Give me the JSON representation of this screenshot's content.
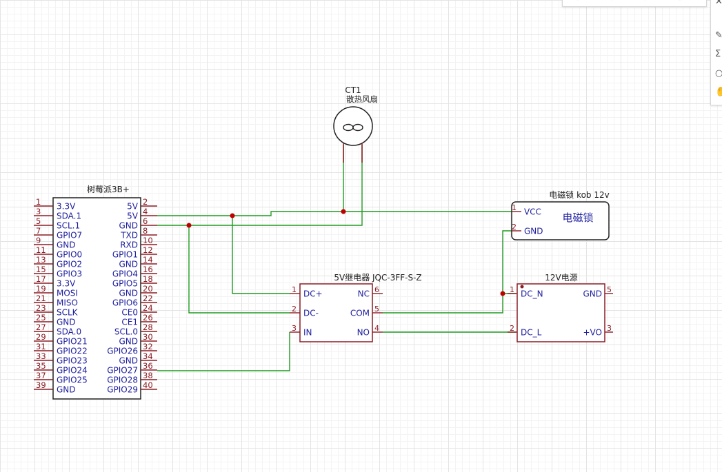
{
  "colors": {
    "symbol": "#8a1c24",
    "wire": "#1f9a1f",
    "junction": "#c00000",
    "label": "#1c1c9e",
    "title": "#202020",
    "pin_number": "#8a1c24"
  },
  "toolbar": {
    "top_glyphs": [
      "«",
      "‹",
      "›",
      "»"
    ],
    "side_icons": [
      "close-icon",
      "pencil-icon",
      "sigma-icon",
      "circle-icon",
      "hand-icon"
    ],
    "side_glyphs": [
      "✕",
      "✎",
      "Σ",
      "○",
      "✋"
    ]
  },
  "components": {
    "rpi": {
      "title": "树莓派3B+",
      "left_pins": [
        {
          "num": "1",
          "label": "3.3V"
        },
        {
          "num": "3",
          "label": "SDA.1"
        },
        {
          "num": "5",
          "label": "SCL.1"
        },
        {
          "num": "7",
          "label": "GPIO7"
        },
        {
          "num": "9",
          "label": "GND"
        },
        {
          "num": "11",
          "label": "GPIO0"
        },
        {
          "num": "13",
          "label": "GPIO2"
        },
        {
          "num": "15",
          "label": "GPIO3"
        },
        {
          "num": "17",
          "label": "3.3V"
        },
        {
          "num": "19",
          "label": "MOSI"
        },
        {
          "num": "21",
          "label": "MISO"
        },
        {
          "num": "23",
          "label": "SCLK"
        },
        {
          "num": "25",
          "label": "GND"
        },
        {
          "num": "27",
          "label": "SDA.0"
        },
        {
          "num": "29",
          "label": "GPIO21"
        },
        {
          "num": "31",
          "label": "GPIO22"
        },
        {
          "num": "33",
          "label": "GPIO23"
        },
        {
          "num": "35",
          "label": "GPIO24"
        },
        {
          "num": "37",
          "label": "GPIO25"
        },
        {
          "num": "39",
          "label": "GND"
        }
      ],
      "right_pins": [
        {
          "num": "2",
          "label": "5V"
        },
        {
          "num": "4",
          "label": "5V"
        },
        {
          "num": "6",
          "label": "GND"
        },
        {
          "num": "8",
          "label": "TXD"
        },
        {
          "num": "10",
          "label": "RXD"
        },
        {
          "num": "12",
          "label": "GPIO1"
        },
        {
          "num": "14",
          "label": "GND"
        },
        {
          "num": "16",
          "label": "GPIO4"
        },
        {
          "num": "18",
          "label": "GPIO5"
        },
        {
          "num": "20",
          "label": "GND"
        },
        {
          "num": "22",
          "label": "GPIO6"
        },
        {
          "num": "24",
          "label": "CE0"
        },
        {
          "num": "26",
          "label": "CE1"
        },
        {
          "num": "28",
          "label": "SCL.0"
        },
        {
          "num": "30",
          "label": "GND"
        },
        {
          "num": "32",
          "label": "GPIO26"
        },
        {
          "num": "34",
          "label": "GND"
        },
        {
          "num": "36",
          "label": "GPIO27"
        },
        {
          "num": "38",
          "label": "GPIO28"
        },
        {
          "num": "40",
          "label": "GPIO29"
        }
      ]
    },
    "fan": {
      "ref": "CT1",
      "name": "散热风扇"
    },
    "lock": {
      "title": "电磁锁 kob 12v",
      "center_label": "电磁锁",
      "pins": [
        {
          "num": "1",
          "label": "VCC"
        },
        {
          "num": "2",
          "label": "GND"
        }
      ]
    },
    "relay": {
      "title": "5V继电器 JQC-3FF-S-Z",
      "left_pins": [
        {
          "num": "1",
          "label": "DC+"
        },
        {
          "num": "2",
          "label": "DC-"
        },
        {
          "num": "3",
          "label": "IN"
        }
      ],
      "right_pins": [
        {
          "num": "6",
          "label": "NC"
        },
        {
          "num": "5",
          "label": "COM"
        },
        {
          "num": "4",
          "label": "NO"
        }
      ]
    },
    "psu": {
      "title": "12V电源",
      "left_pins": [
        {
          "num": "1",
          "label": "DC_N"
        },
        {
          "num": "2",
          "label": "DC_L"
        }
      ],
      "right_pins": [
        {
          "num": "5",
          "label": "GND"
        },
        {
          "num": "3",
          "label": "+VO"
        }
      ]
    }
  }
}
